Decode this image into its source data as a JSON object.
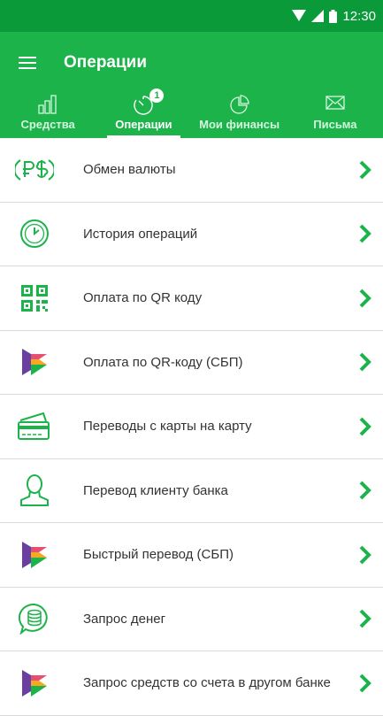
{
  "status_bar": {
    "time": "12:30"
  },
  "header": {
    "title": "Операции"
  },
  "tabs": [
    {
      "label": "Средства",
      "icon": "bar-chart-icon"
    },
    {
      "label": "Операции",
      "icon": "timer-icon",
      "badge": "1",
      "active": true
    },
    {
      "label": "Мои финансы",
      "icon": "pie-chart-icon"
    },
    {
      "label": "Письма",
      "icon": "envelope-icon"
    }
  ],
  "menu": [
    {
      "label": "Обмен валюты",
      "icon": "currency-exchange-icon"
    },
    {
      "label": "История операций",
      "icon": "clock-icon"
    },
    {
      "label": "Оплата по QR коду",
      "icon": "qr-code-icon"
    },
    {
      "label": "Оплата по QR-коду (СБП)",
      "icon": "sbp-logo-icon"
    },
    {
      "label": "Переводы с карты на карту",
      "icon": "cards-icon"
    },
    {
      "label": "Перевод клиенту банка",
      "icon": "person-icon"
    },
    {
      "label": "Быстрый перевод (СБП)",
      "icon": "sbp-logo-icon"
    },
    {
      "label": "Запрос денег",
      "icon": "money-request-icon"
    },
    {
      "label": "Запрос средств со счета в другом банке",
      "icon": "sbp-logo-icon"
    }
  ],
  "colors": {
    "status_bar": "#0a9a3a",
    "app_bar": "#1bb34a",
    "accent": "#1bb34a"
  }
}
